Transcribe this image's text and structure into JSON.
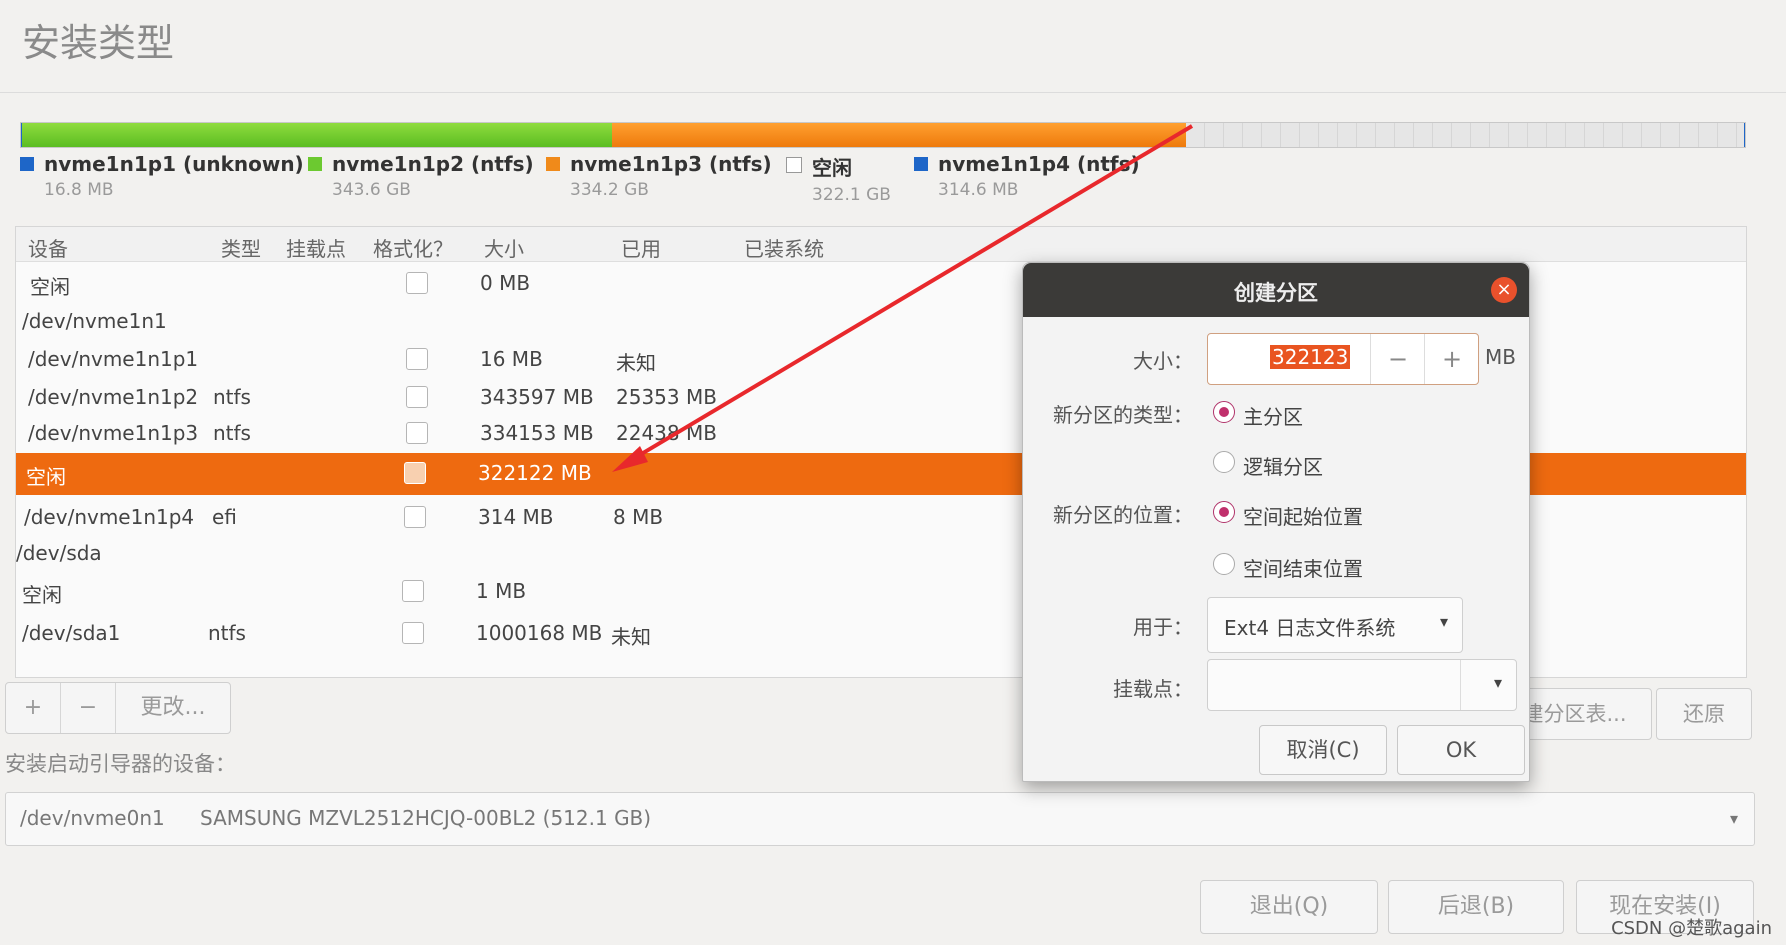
{
  "page": {
    "title": "安装类型"
  },
  "legend": [
    {
      "name": "nvme1n1p1 (unknown)",
      "size": "16.8 MB",
      "color": "#1e66c8"
    },
    {
      "name": "nvme1n1p2 (ntfs)",
      "size": "343.6 GB",
      "color": "#6cc930"
    },
    {
      "name": "nvme1n1p3 (ntfs)",
      "size": "334.2 GB",
      "color": "#f08a1a"
    },
    {
      "name": "空闲",
      "size": "322.1 GB",
      "color": "#ffffff"
    },
    {
      "name": "nvme1n1p4 (ntfs)",
      "size": "314.6 MB",
      "color": "#1e66c8"
    }
  ],
  "table": {
    "headers": {
      "device": "设备",
      "type": "类型",
      "mount": "挂载点",
      "format": "格式化？",
      "size": "大小",
      "used": "已用",
      "system": "已装系统"
    },
    "rows": [
      {
        "device": "空闲",
        "type": "",
        "size": "0 MB",
        "used": "",
        "checkbox": true
      },
      {
        "device": "/dev/nvme1n1",
        "type": "",
        "size": "",
        "used": "",
        "checkbox": false
      },
      {
        "device": "/dev/nvme1n1p1",
        "type": "",
        "size": "16 MB",
        "used": "未知",
        "checkbox": true
      },
      {
        "device": "/dev/nvme1n1p2",
        "type": "ntfs",
        "size": "343597 MB",
        "used": "25353 MB",
        "checkbox": true
      },
      {
        "device": "/dev/nvme1n1p3",
        "type": "ntfs",
        "size": "334153 MB",
        "used": "22438 MB",
        "checkbox": true
      },
      {
        "device": "空闲",
        "type": "",
        "size": "322122 MB",
        "used": "",
        "checkbox": true,
        "selected": true
      },
      {
        "device": "/dev/nvme1n1p4",
        "type": "efi",
        "size": "314 MB",
        "used": "8 MB",
        "checkbox": true
      },
      {
        "device": "/dev/sda",
        "type": "",
        "size": "",
        "used": "",
        "checkbox": false
      },
      {
        "device": "空闲",
        "type": "",
        "size": "1 MB",
        "used": "",
        "checkbox": true
      },
      {
        "device": "/dev/sda1",
        "type": "ntfs",
        "size": "1000168 MB",
        "used": "未知",
        "checkbox": true
      }
    ]
  },
  "table_buttons": {
    "add": "+",
    "remove": "−",
    "change": "更改..."
  },
  "right_buttons": {
    "new_table": "新建分区表...",
    "revert": "还原"
  },
  "boot": {
    "label": "安装启动引导器的设备：",
    "device": "/dev/nvme0n1",
    "description": "SAMSUNG MZVL2512HCJQ-00BL2 (512.1 GB)"
  },
  "bottom_buttons": {
    "quit": "退出(Q)",
    "back": "后退(B)",
    "install": "现在安装(I)"
  },
  "watermark": "CSDN @楚歌again",
  "dialog": {
    "title": "创建分区",
    "close_icon": "×",
    "size_label": "大小：",
    "size_value": "322123",
    "minus": "−",
    "plus": "+",
    "unit": "MB",
    "type_label": "新分区的类型：",
    "type_primary": "主分区",
    "type_logical": "逻辑分区",
    "type_selected": "primary",
    "location_label": "新分区的位置：",
    "location_start": "空间起始位置",
    "location_end": "空间结束位置",
    "location_selected": "start",
    "use_label": "用于：",
    "use_value": "Ext4 日志文件系统",
    "mount_label": "挂载点：",
    "mount_value": "",
    "cancel": "取消(C)",
    "ok": "OK"
  },
  "colors": {
    "accent": "#ee6a10",
    "close": "#e9512c",
    "radio": "#c0306c",
    "annotation_arrow": "#e8282c"
  }
}
